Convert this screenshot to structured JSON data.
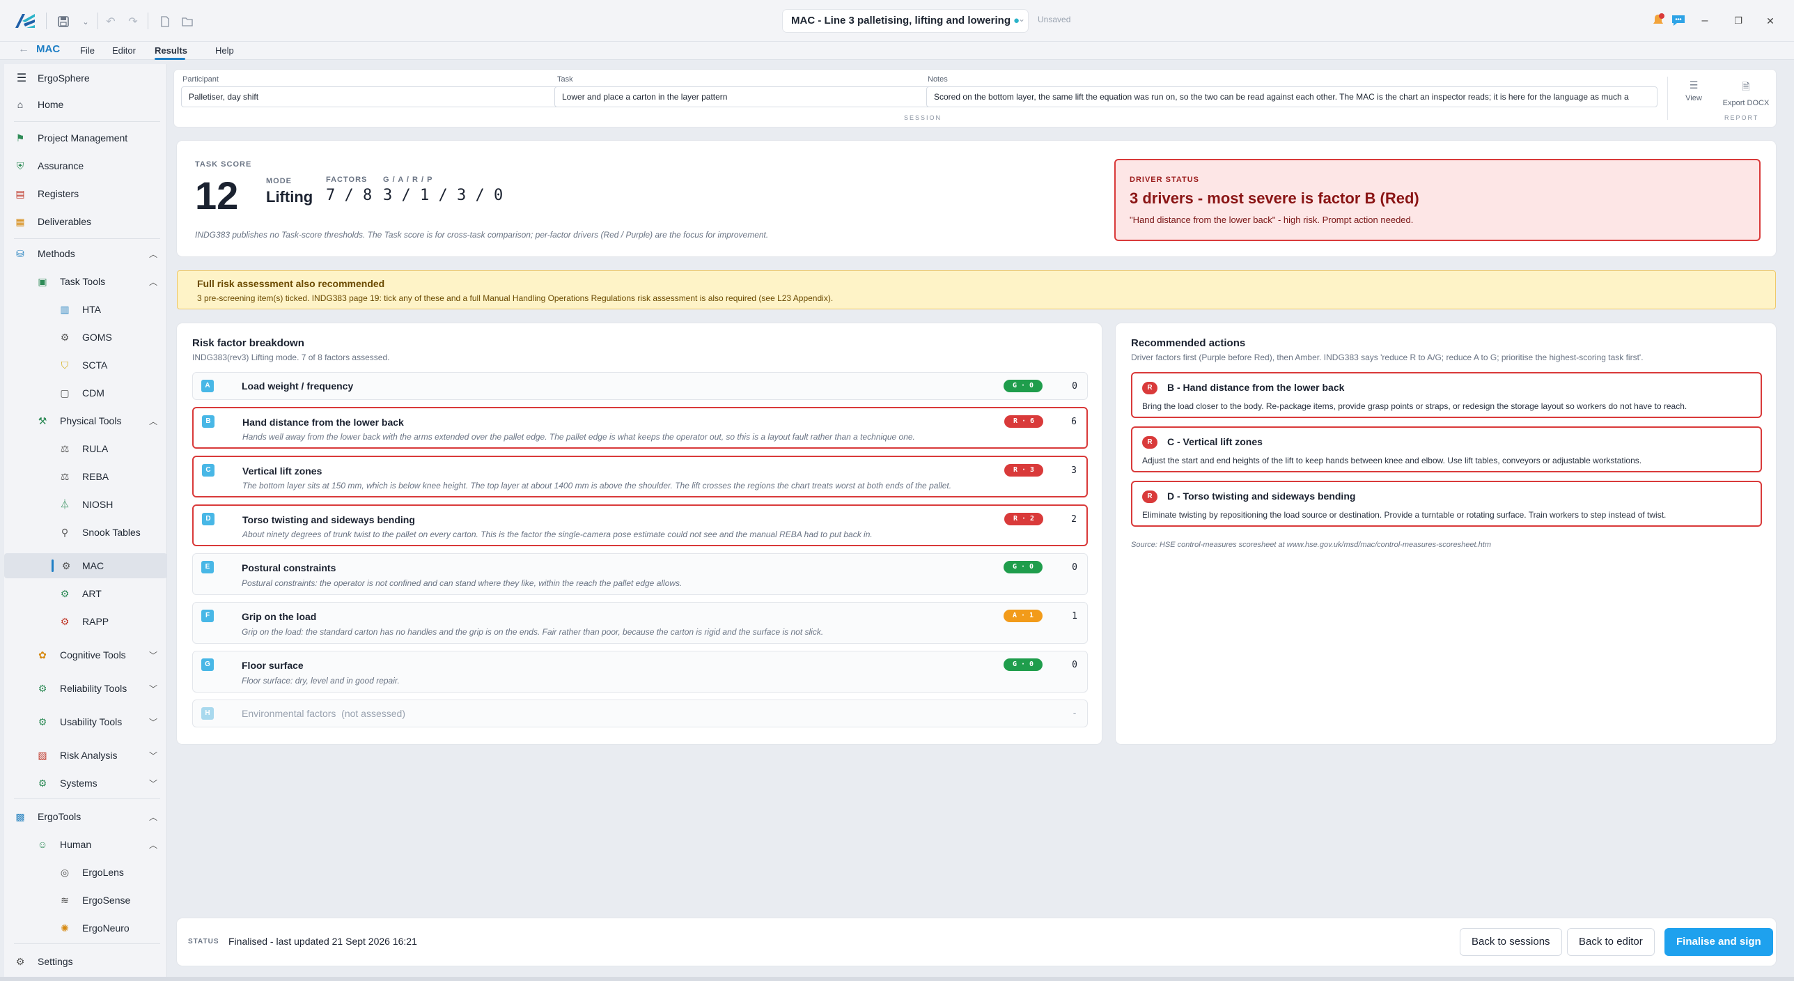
{
  "window": {
    "title": "MAC - Line 3 palletising, lifting and lowering",
    "unsaved_dot": "●",
    "unsaved_label": "Unsaved",
    "minimize": "–",
    "restore": "❐",
    "close": "✕"
  },
  "menubar": {
    "back": "←",
    "app": "MAC",
    "items": [
      "File",
      "Editor",
      "Results",
      "Help"
    ],
    "active": "Results"
  },
  "sidebar": {
    "brand": "ErgoSphere",
    "items": [
      {
        "label": "Home"
      },
      {
        "label": "Project Management"
      },
      {
        "label": "Assurance"
      },
      {
        "label": "Registers"
      },
      {
        "label": "Deliverables"
      },
      {
        "label": "Methods"
      },
      {
        "label": "Task Tools"
      },
      {
        "label": "HTA"
      },
      {
        "label": "GOMS"
      },
      {
        "label": "SCTA"
      },
      {
        "label": "CDM"
      },
      {
        "label": "Physical Tools"
      },
      {
        "label": "RULA"
      },
      {
        "label": "REBA"
      },
      {
        "label": "NIOSH"
      },
      {
        "label": "Snook Tables"
      },
      {
        "label": "MAC"
      },
      {
        "label": "ART"
      },
      {
        "label": "RAPP"
      },
      {
        "label": "Cognitive Tools"
      },
      {
        "label": "Reliability Tools"
      },
      {
        "label": "Usability Tools"
      },
      {
        "label": "Risk Analysis"
      },
      {
        "label": "Systems"
      },
      {
        "label": "ErgoTools"
      },
      {
        "label": "Human"
      },
      {
        "label": "ErgoLens"
      },
      {
        "label": "ErgoSense"
      },
      {
        "label": "ErgoNeuro"
      },
      {
        "label": "Settings"
      }
    ]
  },
  "session": {
    "participant_label": "Participant",
    "participant_value": "Palletiser, day shift",
    "task_label": "Task",
    "task_value": "Lower and place a carton in the layer pattern",
    "notes_label": "Notes",
    "notes_value": "Scored on the bottom layer, the same lift the equation was run on, so the two can be read against each other. The MAC is the chart an inspector reads; it is here for the language as much a",
    "section_caption": "SESSION",
    "view_label": "View",
    "export_label": "Export DOCX",
    "report_caption": "REPORT"
  },
  "score": {
    "label": "TASK SCORE",
    "value": "12",
    "mode_label": "MODE",
    "mode_value": "Lifting",
    "factors_label": "FACTORS",
    "factors_value": "7 / 8",
    "gar_label": "G / A / R / P",
    "gar_value": "3 / 1 / 3 / 0",
    "note": "INDG383 publishes no Task-score thresholds. The Task score is for cross-task comparison; per-factor drivers (Red / Purple) are the focus for improvement."
  },
  "driver": {
    "label": "DRIVER STATUS",
    "title": "3 drivers - most severe is factor B (Red)",
    "subtitle": "\"Hand distance from the lower back\" - high risk. Prompt action needed."
  },
  "banner": {
    "title": "Full risk assessment also recommended",
    "text": "3 pre-screening item(s) ticked. INDG383 page 19: tick any of these and a full Manual Handling Operations Regulations risk assessment is also required (see L23 Appendix)."
  },
  "breakdown": {
    "title": "Risk factor breakdown",
    "subtitle": "INDG383(rev3) Lifting mode. 7 of 8 factors assessed.",
    "factors": [
      {
        "letter": "A",
        "name": "Load weight / frequency",
        "desc": "",
        "pill": "G · 0",
        "color": "g",
        "score": "0"
      },
      {
        "letter": "B",
        "name": "Hand distance from the lower back",
        "desc": "Hands well away from the lower back with the arms extended over the pallet edge. The pallet edge is what keeps the operator out, so this is a layout fault rather than a technique one.",
        "pill": "R · 6",
        "color": "r",
        "score": "6"
      },
      {
        "letter": "C",
        "name": "Vertical lift zones",
        "desc": "The bottom layer sits at 150 mm, which is below knee height. The top layer at about 1400 mm is above the shoulder. The lift crosses the regions the chart treats worst at both ends of the pallet.",
        "pill": "R · 3",
        "color": "r",
        "score": "3"
      },
      {
        "letter": "D",
        "name": "Torso twisting and sideways bending",
        "desc": "About ninety degrees of trunk twist to the pallet on every carton. This is the factor the single-camera pose estimate could not see and the manual REBA had to put back in.",
        "pill": "R · 2",
        "color": "r",
        "score": "2"
      },
      {
        "letter": "E",
        "name": "Postural constraints",
        "desc": "Postural constraints: the operator is not confined and can stand where they like, within the reach the pallet edge allows.",
        "pill": "G · 0",
        "color": "g",
        "score": "0"
      },
      {
        "letter": "F",
        "name": "Grip on the load",
        "desc": "Grip on the load: the standard carton has no handles and the grip is on the ends. Fair rather than poor, because the carton is rigid and the surface is not slick.",
        "pill": "A · 1",
        "color": "a",
        "score": "1"
      },
      {
        "letter": "G",
        "name": "Floor surface",
        "desc": "Floor surface: dry, level and in good repair.",
        "pill": "G · 0",
        "color": "g",
        "score": "0"
      },
      {
        "letter": "H",
        "name": "Environmental factors  (not assessed)",
        "desc": "",
        "pill": "",
        "color": "",
        "score": "-"
      }
    ]
  },
  "actions": {
    "title": "Recommended actions",
    "subtitle": "Driver factors first (Purple before Red), then Amber. INDG383 says 'reduce R to A/G; reduce A to G; prioritise the highest-scoring task first'.",
    "items": [
      {
        "badge": "R",
        "title": "B - Hand distance from the lower back",
        "desc": "Bring the load closer to the body. Re-package items, provide grasp points or straps, or redesign the storage layout so workers do not have to reach."
      },
      {
        "badge": "R",
        "title": "C - Vertical lift zones",
        "desc": "Adjust the start and end heights of the lift to keep hands between knee and elbow. Use lift tables, conveyors or adjustable workstations."
      },
      {
        "badge": "R",
        "title": "D - Torso twisting and sideways bending",
        "desc": "Eliminate twisting by repositioning the load source or destination. Provide a turntable or rotating surface. Train workers to step instead of twist."
      }
    ],
    "source": "Source: HSE control-measures scoresheet at www.hse.gov.uk/msd/mac/control-measures-scoresheet.htm"
  },
  "status": {
    "label": "STATUS",
    "text": "Finalised - last updated 21 Sept 2026 16:21",
    "back_sessions": "Back to sessions",
    "back_editor": "Back to editor",
    "finalise": "Finalise and sign"
  }
}
